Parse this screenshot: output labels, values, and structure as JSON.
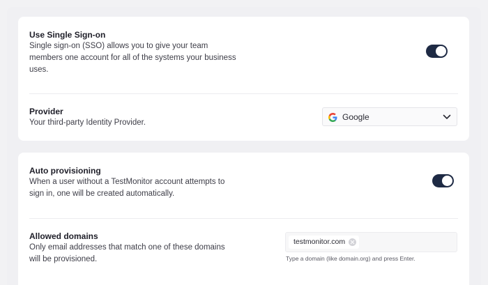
{
  "sso_card": {
    "sso": {
      "title": "Use Single Sign-on",
      "description": "Single sign-on (SSO) allows you to give your team members one account for all of the systems your business uses.",
      "toggle_on": true
    },
    "provider": {
      "title": "Provider",
      "description": "Your third-party Identity Provider.",
      "selected": "Google",
      "icon": "google-icon"
    }
  },
  "provisioning_card": {
    "auto": {
      "title": "Auto provisioning",
      "description": "When a user without a TestMonitor account attempts to sign in, one will be created automatically.",
      "toggle_on": true
    },
    "domains": {
      "title": "Allowed domains",
      "description": "Only email addresses that match one of these domains will be provisioned.",
      "tags": [
        "testmonitor.com"
      ],
      "hint": "Type a domain (like domain.org) and press Enter."
    }
  },
  "colors": {
    "toggle_on": "#1e2a44",
    "background": "#f2f2f4",
    "card": "#ffffff"
  }
}
